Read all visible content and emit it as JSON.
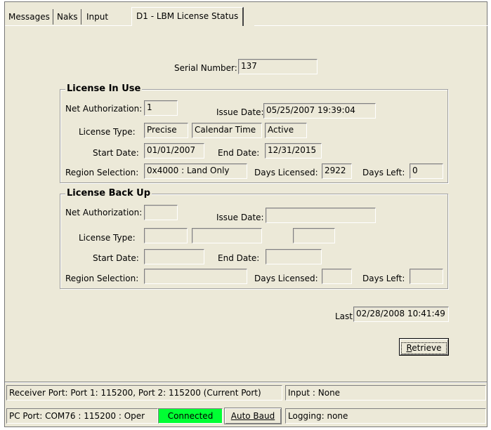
{
  "tabs": [
    {
      "label": "Messages"
    },
    {
      "label": "Naks"
    },
    {
      "label": "Input"
    },
    {
      "label": "D1 - LBM License Status"
    }
  ],
  "serial": {
    "label": "Serial Number:",
    "value": "137"
  },
  "in_use": {
    "title": "License In Use",
    "net_auth_label": "Net Authorization:",
    "net_auth": "1",
    "issue_date_label": "Issue Date:",
    "issue_date": "05/25/2007 19:39:04",
    "license_type_label": "License Type:",
    "type1": "Precise",
    "type2": "Calendar Time",
    "type3": "Active",
    "start_label": "Start Date:",
    "start": "01/01/2007",
    "end_label": "End Date:",
    "end": "12/31/2015",
    "region_label": "Region Selection:",
    "region": "0x4000 : Land Only",
    "days_licensed_label": "Days Licensed:",
    "days_licensed": "2922",
    "days_left_label": "Days Left:",
    "days_left": "0"
  },
  "backup": {
    "title": "License Back Up",
    "net_auth_label": "Net Authorization:",
    "net_auth": "",
    "issue_date_label": "Issue Date:",
    "issue_date": "",
    "license_type_label": "License Type:",
    "type1": "",
    "type2": "",
    "type3": "",
    "start_label": "Start Date:",
    "start": "",
    "end_label": "End Date:",
    "end": "",
    "region_label": "Region Selection:",
    "region": "",
    "days_licensed_label": "Days Licensed:",
    "days_licensed": "",
    "days_left_label": "Days Left:",
    "days_left": ""
  },
  "last": {
    "label": "Last:",
    "value": "02/28/2008 10:41:49"
  },
  "retrieve_button": {
    "mnemonic": "R",
    "rest": "etrieve"
  },
  "status": {
    "receiver_label": "Receiver Port:",
    "receiver_value": "Port 1: 115200, Port 2: 115200 (Current Port)",
    "input_value": "Input : None",
    "pc_label": "PC Port:",
    "pc_value": "COM76 : 115200 : Oper",
    "connected": "Connected",
    "connected_color": "#00ff33",
    "auto_baud": "Auto Baud",
    "logging": "Logging: none"
  }
}
